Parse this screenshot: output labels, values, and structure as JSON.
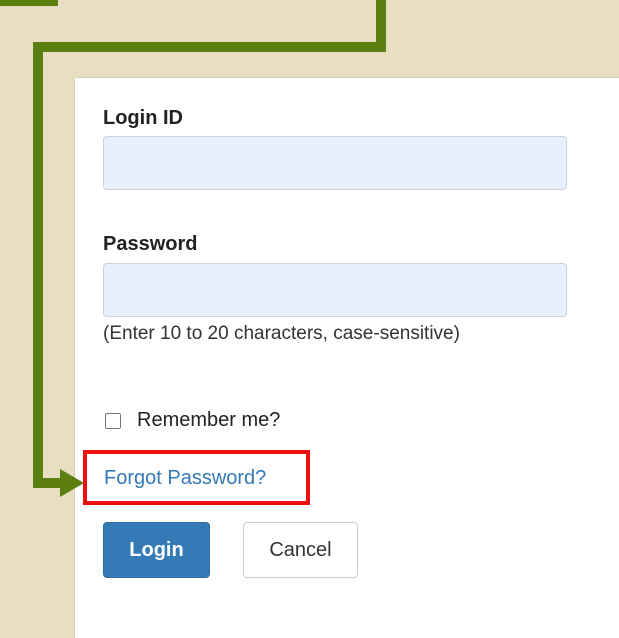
{
  "form": {
    "login_id_label": "Login ID",
    "login_id_value": "",
    "password_label": "Password",
    "password_value": "",
    "password_hint": "(Enter 10 to 20 characters, case-sensitive)",
    "remember_me_label": "Remember me?",
    "remember_me_checked": false,
    "forgot_password_link": "Forgot Password?",
    "login_button": "Login",
    "cancel_button": "Cancel"
  },
  "annotation": {
    "arrow_color": "#5b7f10",
    "highlight_color": "#ee1111"
  },
  "colors": {
    "background": "#e8dfc3",
    "panel": "#ffffff",
    "input_fill": "#e8f0fe",
    "primary": "#337ab7",
    "link": "#337ab7"
  },
  "icons": {
    "annotation_arrow": "arrow-right-icon"
  }
}
